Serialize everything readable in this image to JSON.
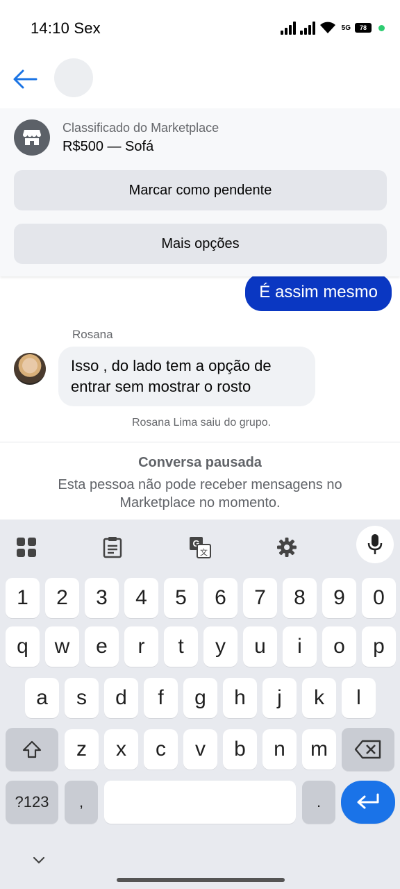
{
  "status": {
    "time": "14:10 Sex",
    "network": "5G",
    "battery": "78"
  },
  "marketplace": {
    "label": "Classificado do Marketplace",
    "item": "R$500 — Sofá",
    "mark_pending_button": "Marcar como pendente",
    "more_options_button": "Mais opções"
  },
  "messages": {
    "outgoing": "É assim mesmo",
    "sender_name": "Rosana",
    "incoming_line1": "Isso , do lado tem a opção de",
    "incoming_line2": "entrar sem mostrar o rosto",
    "system_note": "Rosana Lima saiu do grupo."
  },
  "paused": {
    "title": "Conversa pausada",
    "description_line1": "Esta pessoa não pode receber mensagens no",
    "description_line2": "Marketplace no momento."
  },
  "keyboard": {
    "numbers": [
      "1",
      "2",
      "3",
      "4",
      "5",
      "6",
      "7",
      "8",
      "9",
      "0"
    ],
    "row1": [
      "q",
      "w",
      "e",
      "r",
      "t",
      "y",
      "u",
      "i",
      "o",
      "p"
    ],
    "row2": [
      "a",
      "s",
      "d",
      "f",
      "g",
      "h",
      "j",
      "k",
      "l"
    ],
    "row3": [
      "z",
      "x",
      "c",
      "v",
      "b",
      "n",
      "m"
    ],
    "symbols_key": "?123",
    "comma_key": ",",
    "period_key": "."
  },
  "colors": {
    "outgoing_bubble": "#0a37c2",
    "incoming_bubble": "#f0f2f5",
    "back_arrow": "#1b74e4",
    "enter_key": "#1a73e8"
  }
}
